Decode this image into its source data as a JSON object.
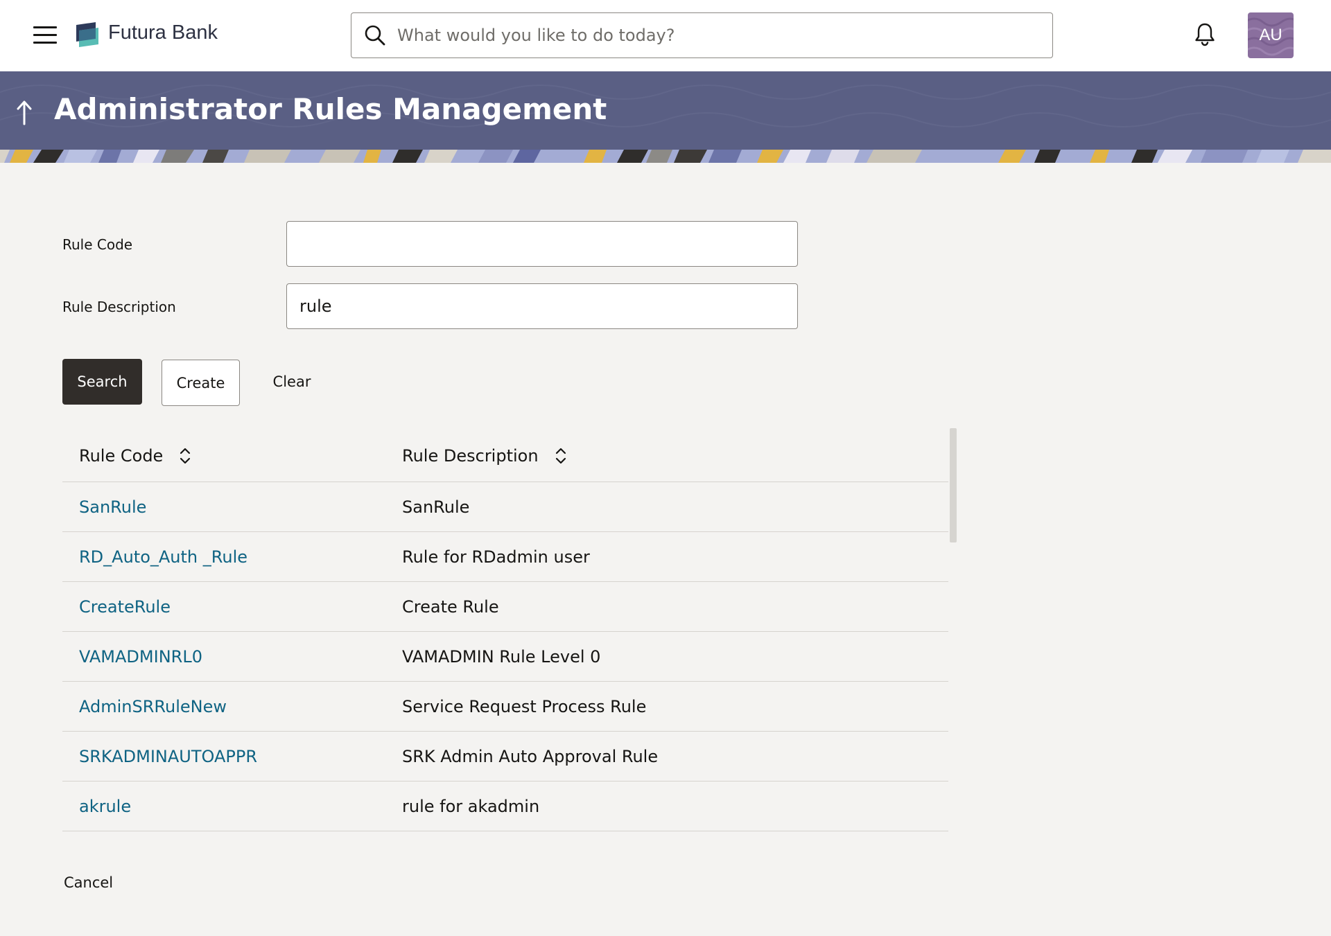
{
  "header": {
    "brand": "Futura Bank",
    "search_placeholder": "What would you like to do today?",
    "avatar_initials": "AU",
    "colors": {
      "avatar_bg": "#8a6f9e",
      "brand_text": "#2d3142"
    }
  },
  "banner": {
    "title": "Administrator Rules Management",
    "color": "#5a5f84"
  },
  "form": {
    "rule_code_label": "Rule Code",
    "rule_code_value": "",
    "rule_description_label": "Rule Description",
    "rule_description_value": "rule",
    "search_label": "Search",
    "create_label": "Create",
    "clear_label": "Clear"
  },
  "table": {
    "columns": [
      "Rule Code",
      "Rule Description"
    ],
    "rows": [
      {
        "code": "SanRule",
        "description": "SanRule"
      },
      {
        "code": "RD_Auto_Auth _Rule",
        "description": "Rule for RDadmin user"
      },
      {
        "code": "CreateRule",
        "description": "Create Rule"
      },
      {
        "code": "VAMADMINRL0",
        "description": "VAMADMIN Rule Level 0"
      },
      {
        "code": "AdminSRRuleNew",
        "description": "Service Request Process Rule"
      },
      {
        "code": "SRKADMINAUTOAPPR",
        "description": "SRK Admin Auto Approval Rule"
      },
      {
        "code": "akrule",
        "description": "rule for akadmin"
      }
    ],
    "link_color": "#0f6383"
  },
  "footer": {
    "cancel_label": "Cancel"
  },
  "icons": [
    "hamburger-menu-icon",
    "logo-icon",
    "search-icon",
    "bell-icon",
    "back-arrow-icon",
    "sort-icon"
  ]
}
